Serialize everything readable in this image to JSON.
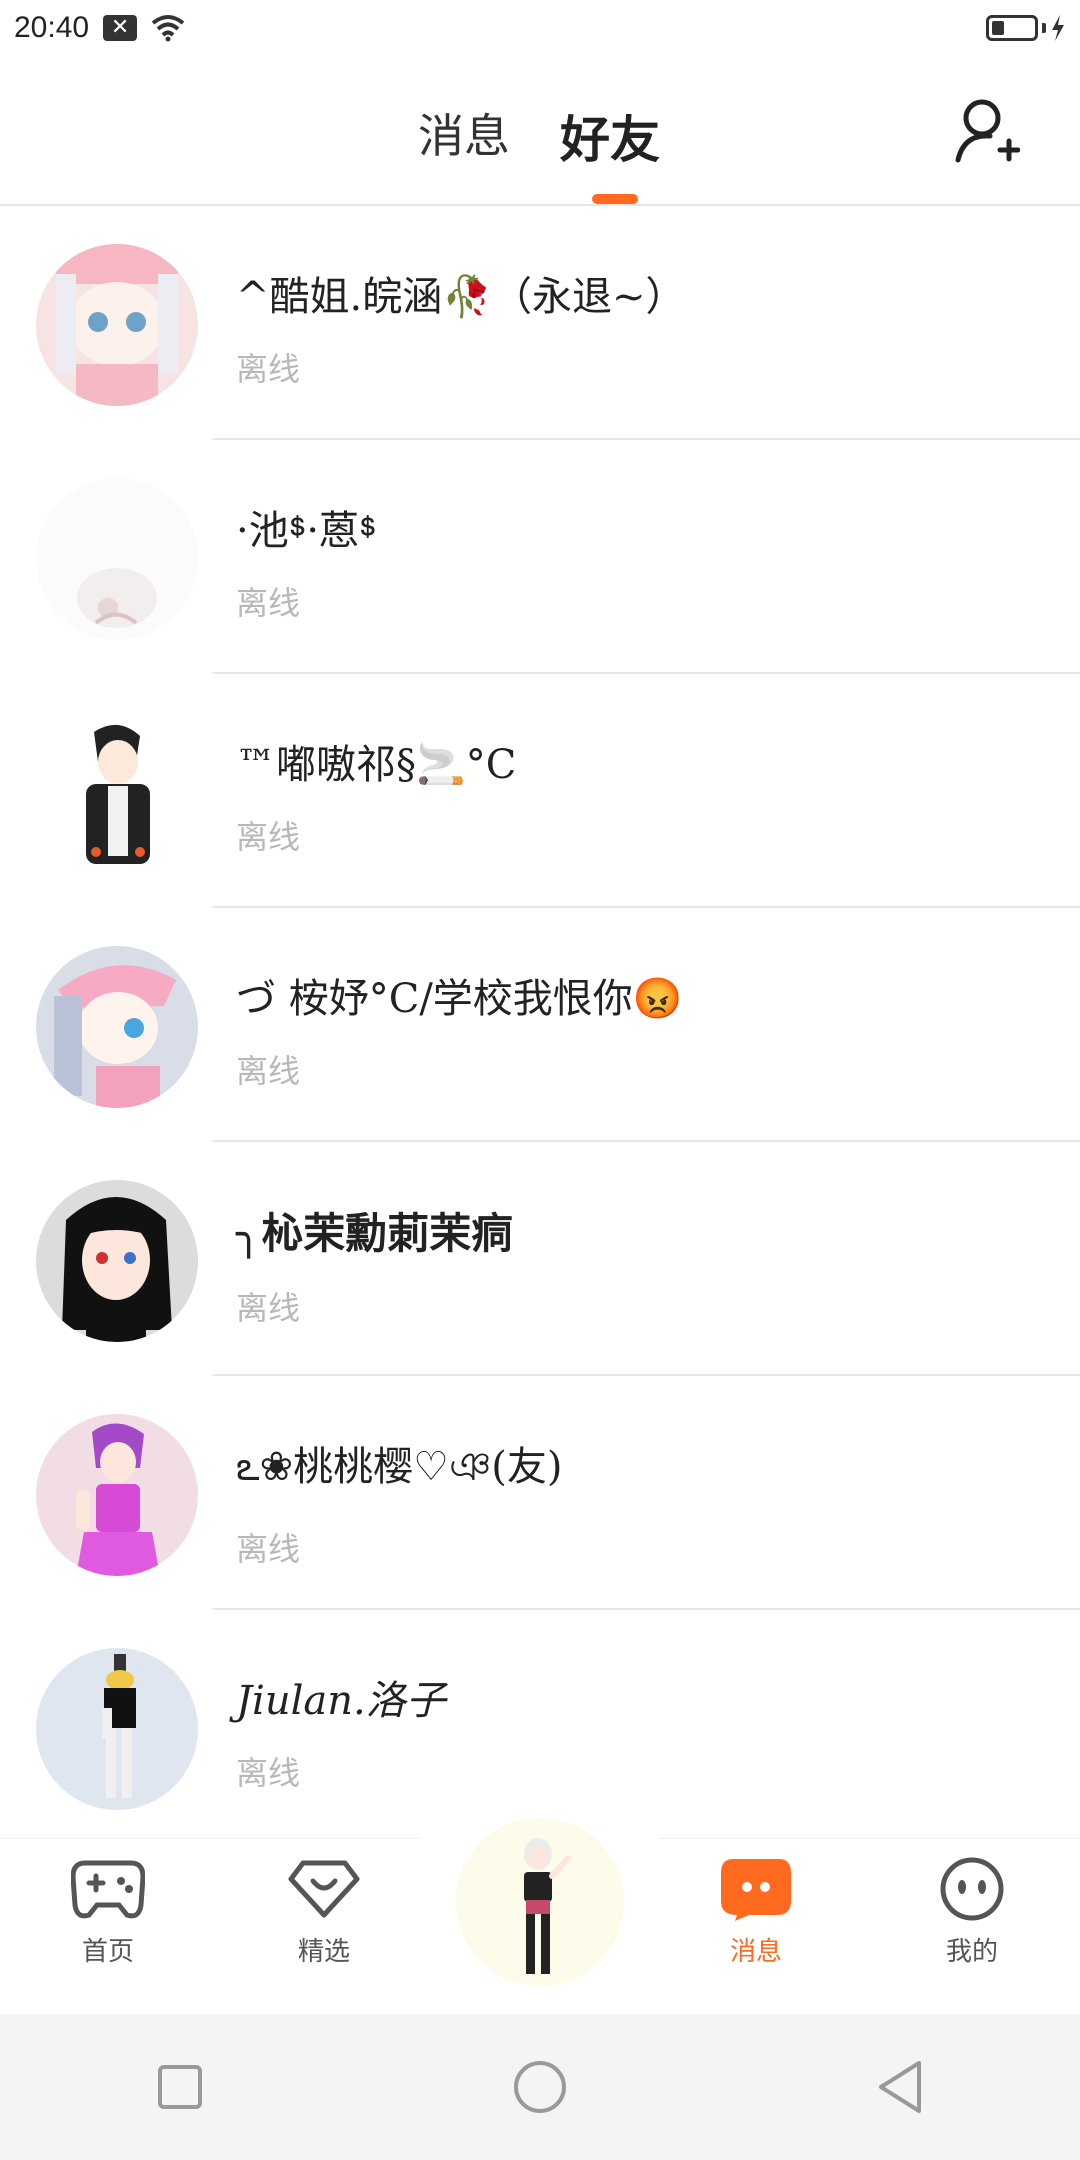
{
  "status_bar": {
    "time": "20:40",
    "notification_icon": "x-box-icon",
    "wifi_icon": "wifi-icon",
    "battery_icon": "battery-charging-icon"
  },
  "header": {
    "tabs": [
      {
        "label": "消息",
        "active": false
      },
      {
        "label": "好友",
        "active": true
      }
    ],
    "accent_color": "#ff6a1f",
    "add_friend_icon": "add-user-icon"
  },
  "friends": [
    {
      "name": "^酷姐.皖涵🥀（永退~）",
      "status": "离线",
      "avatar": "anime-girl-pink-hair"
    },
    {
      "name": "·池ᙚ·蒽ᙚ",
      "status": "离线",
      "avatar": "faded-figure"
    },
    {
      "name": "™嘟嗷祁§🚬°C",
      "status": "离线",
      "avatar": "anime-boy-jacket"
    },
    {
      "name": "づ 桉妤°C/学校我恨你😡",
      "status": "离线",
      "avatar": "anime-girl-cap"
    },
    {
      "name": "╮杺茉勳莿茉痌",
      "status": "离线",
      "avatar": "anime-girl-black-hair"
    },
    {
      "name": "ఽ❀桃桃樱♡ঞ(友)",
      "status": "离线",
      "avatar": "anime-girl-purple"
    },
    {
      "name": "Jiulan.洛子",
      "status": "离线",
      "avatar": "anime-girl-white-hair"
    }
  ],
  "bottom_nav": {
    "items": [
      {
        "label": "首页",
        "icon": "gamepad-icon",
        "active": false
      },
      {
        "label": "精选",
        "icon": "heart-diamond-icon",
        "active": false
      },
      {
        "label": "消息",
        "icon": "chat-bubble-icon",
        "active": true
      },
      {
        "label": "我的",
        "icon": "face-icon",
        "active": false
      }
    ],
    "center_icon": "avatar-character-icon"
  },
  "system_nav": {
    "recent_icon": "square-icon",
    "home_icon": "circle-icon",
    "back_icon": "triangle-back-icon"
  }
}
